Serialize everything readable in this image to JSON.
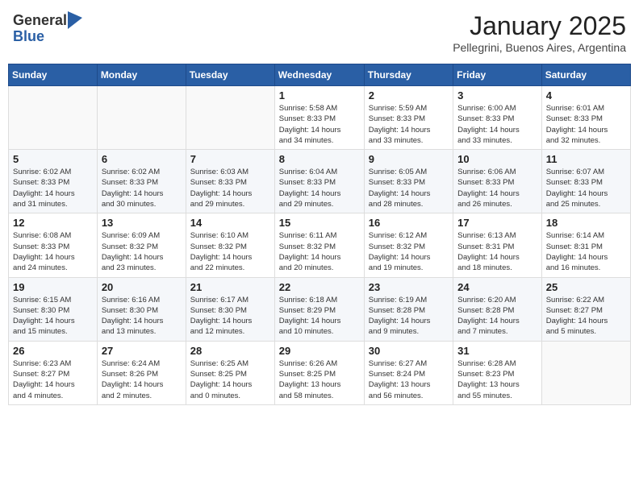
{
  "header": {
    "logo_general": "General",
    "logo_blue": "Blue",
    "title": "January 2025",
    "location": "Pellegrini, Buenos Aires, Argentina"
  },
  "days_of_week": [
    "Sunday",
    "Monday",
    "Tuesday",
    "Wednesday",
    "Thursday",
    "Friday",
    "Saturday"
  ],
  "weeks": [
    [
      {
        "day": "",
        "info": ""
      },
      {
        "day": "",
        "info": ""
      },
      {
        "day": "",
        "info": ""
      },
      {
        "day": "1",
        "info": "Sunrise: 5:58 AM\nSunset: 8:33 PM\nDaylight: 14 hours\nand 34 minutes."
      },
      {
        "day": "2",
        "info": "Sunrise: 5:59 AM\nSunset: 8:33 PM\nDaylight: 14 hours\nand 33 minutes."
      },
      {
        "day": "3",
        "info": "Sunrise: 6:00 AM\nSunset: 8:33 PM\nDaylight: 14 hours\nand 33 minutes."
      },
      {
        "day": "4",
        "info": "Sunrise: 6:01 AM\nSunset: 8:33 PM\nDaylight: 14 hours\nand 32 minutes."
      }
    ],
    [
      {
        "day": "5",
        "info": "Sunrise: 6:02 AM\nSunset: 8:33 PM\nDaylight: 14 hours\nand 31 minutes."
      },
      {
        "day": "6",
        "info": "Sunrise: 6:02 AM\nSunset: 8:33 PM\nDaylight: 14 hours\nand 30 minutes."
      },
      {
        "day": "7",
        "info": "Sunrise: 6:03 AM\nSunset: 8:33 PM\nDaylight: 14 hours\nand 29 minutes."
      },
      {
        "day": "8",
        "info": "Sunrise: 6:04 AM\nSunset: 8:33 PM\nDaylight: 14 hours\nand 29 minutes."
      },
      {
        "day": "9",
        "info": "Sunrise: 6:05 AM\nSunset: 8:33 PM\nDaylight: 14 hours\nand 28 minutes."
      },
      {
        "day": "10",
        "info": "Sunrise: 6:06 AM\nSunset: 8:33 PM\nDaylight: 14 hours\nand 26 minutes."
      },
      {
        "day": "11",
        "info": "Sunrise: 6:07 AM\nSunset: 8:33 PM\nDaylight: 14 hours\nand 25 minutes."
      }
    ],
    [
      {
        "day": "12",
        "info": "Sunrise: 6:08 AM\nSunset: 8:33 PM\nDaylight: 14 hours\nand 24 minutes."
      },
      {
        "day": "13",
        "info": "Sunrise: 6:09 AM\nSunset: 8:32 PM\nDaylight: 14 hours\nand 23 minutes."
      },
      {
        "day": "14",
        "info": "Sunrise: 6:10 AM\nSunset: 8:32 PM\nDaylight: 14 hours\nand 22 minutes."
      },
      {
        "day": "15",
        "info": "Sunrise: 6:11 AM\nSunset: 8:32 PM\nDaylight: 14 hours\nand 20 minutes."
      },
      {
        "day": "16",
        "info": "Sunrise: 6:12 AM\nSunset: 8:32 PM\nDaylight: 14 hours\nand 19 minutes."
      },
      {
        "day": "17",
        "info": "Sunrise: 6:13 AM\nSunset: 8:31 PM\nDaylight: 14 hours\nand 18 minutes."
      },
      {
        "day": "18",
        "info": "Sunrise: 6:14 AM\nSunset: 8:31 PM\nDaylight: 14 hours\nand 16 minutes."
      }
    ],
    [
      {
        "day": "19",
        "info": "Sunrise: 6:15 AM\nSunset: 8:30 PM\nDaylight: 14 hours\nand 15 minutes."
      },
      {
        "day": "20",
        "info": "Sunrise: 6:16 AM\nSunset: 8:30 PM\nDaylight: 14 hours\nand 13 minutes."
      },
      {
        "day": "21",
        "info": "Sunrise: 6:17 AM\nSunset: 8:30 PM\nDaylight: 14 hours\nand 12 minutes."
      },
      {
        "day": "22",
        "info": "Sunrise: 6:18 AM\nSunset: 8:29 PM\nDaylight: 14 hours\nand 10 minutes."
      },
      {
        "day": "23",
        "info": "Sunrise: 6:19 AM\nSunset: 8:28 PM\nDaylight: 14 hours\nand 9 minutes."
      },
      {
        "day": "24",
        "info": "Sunrise: 6:20 AM\nSunset: 8:28 PM\nDaylight: 14 hours\nand 7 minutes."
      },
      {
        "day": "25",
        "info": "Sunrise: 6:22 AM\nSunset: 8:27 PM\nDaylight: 14 hours\nand 5 minutes."
      }
    ],
    [
      {
        "day": "26",
        "info": "Sunrise: 6:23 AM\nSunset: 8:27 PM\nDaylight: 14 hours\nand 4 minutes."
      },
      {
        "day": "27",
        "info": "Sunrise: 6:24 AM\nSunset: 8:26 PM\nDaylight: 14 hours\nand 2 minutes."
      },
      {
        "day": "28",
        "info": "Sunrise: 6:25 AM\nSunset: 8:25 PM\nDaylight: 14 hours\nand 0 minutes."
      },
      {
        "day": "29",
        "info": "Sunrise: 6:26 AM\nSunset: 8:25 PM\nDaylight: 13 hours\nand 58 minutes."
      },
      {
        "day": "30",
        "info": "Sunrise: 6:27 AM\nSunset: 8:24 PM\nDaylight: 13 hours\nand 56 minutes."
      },
      {
        "day": "31",
        "info": "Sunrise: 6:28 AM\nSunset: 8:23 PM\nDaylight: 13 hours\nand 55 minutes."
      },
      {
        "day": "",
        "info": ""
      }
    ]
  ]
}
